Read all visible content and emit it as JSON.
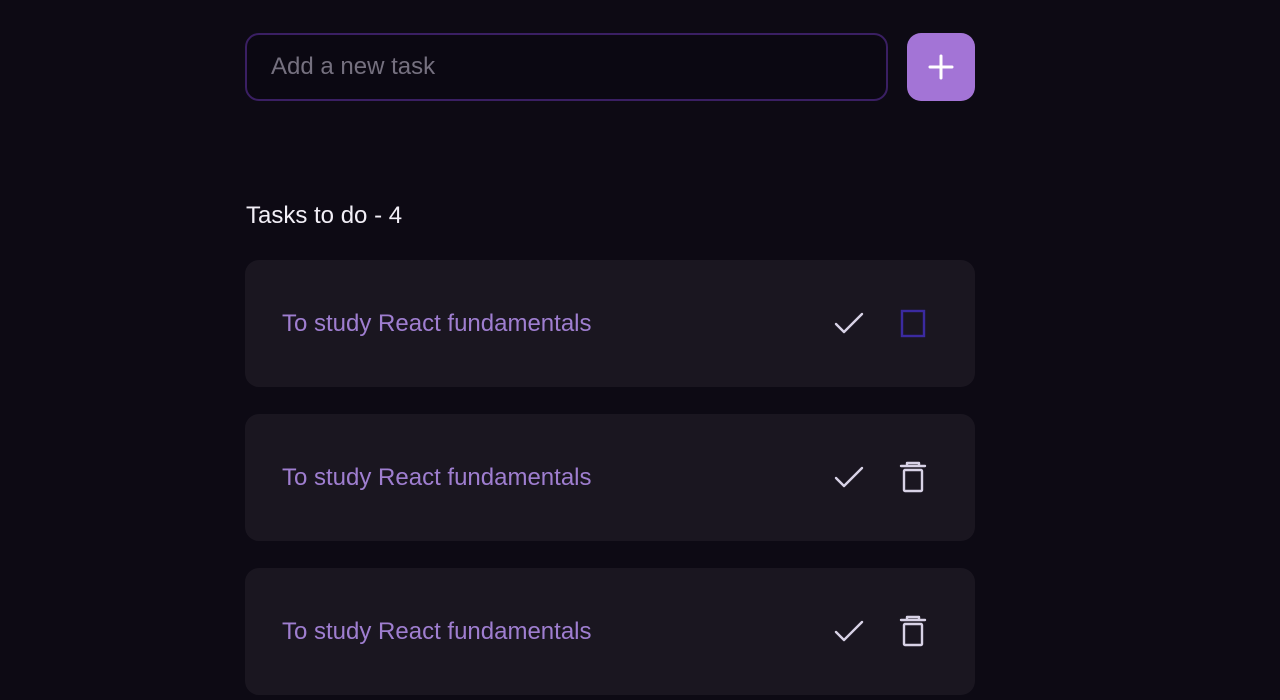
{
  "new_task": {
    "placeholder": "Add a new task",
    "value": "",
    "add_button_icon": "plus-icon"
  },
  "tasks_header": {
    "label": "Tasks to do - 4"
  },
  "tasks": [
    {
      "text": "To study React fundamentals",
      "complete_icon": "check-icon",
      "delete_icon": "trash-icon",
      "delete_icon_state": "outlined-purple"
    },
    {
      "text": "To study React fundamentals",
      "complete_icon": "check-icon",
      "delete_icon": "trash-icon",
      "delete_icon_state": "default"
    },
    {
      "text": "To study React fundamentals",
      "complete_icon": "check-icon",
      "delete_icon": "trash-icon",
      "delete_icon_state": "default"
    }
  ],
  "colors": {
    "background": "#0d0a14",
    "accent": "#a374d6",
    "input_border": "#3a1f63",
    "card": "#1a1620",
    "task_text": "#9f7ed0",
    "icon": "#d8d2e6",
    "delete_highlight": "#3b2aa0"
  }
}
